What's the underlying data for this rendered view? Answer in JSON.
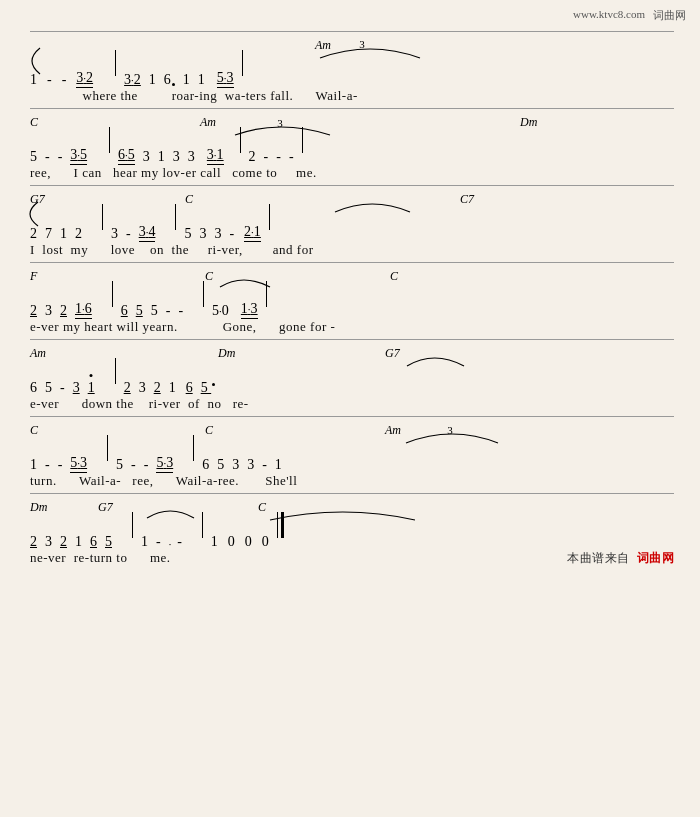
{
  "site": {
    "url": "www.ktvc8.com",
    "label": "词曲网"
  },
  "footer": {
    "source_text": "本曲谱来自",
    "site_label": "词曲网"
  },
  "rows": [
    {
      "id": "row1",
      "notation": "1   -   -   3·2 | 3·2  1  6  1  1   5·3 |",
      "chord_left": "",
      "chord_mid": "Am",
      "lyric": "where the         roar-ing  wa-ters  fall.       Wail-a-"
    },
    {
      "id": "row2",
      "notation": "5  -  -  3·5 | 6·5  3  1  3  3  3·1 | 2  -  -  -",
      "chord_left": "C",
      "chord_mid": "Am",
      "chord_right": "Dm",
      "lyric": "ree,      I can   hear my  lov-er call  come to    me."
    },
    {
      "id": "row3",
      "notation": "2  7  1  2 | 3  -  3·4 | 5  3  3  -  2·1 |",
      "chord_left": "G7",
      "chord_mid": "C",
      "chord_right": "C7",
      "lyric": "I  lost  my      love   on  the    ri-ver,      and for"
    },
    {
      "id": "row4",
      "notation": "2  3  2  1·6 | 6  5  5  -  - | 5·0  1·3 |",
      "chord_left": "F",
      "chord_mid": "C",
      "chord_right": "C",
      "lyric": "e-ver my heart will yearn.         Gone,    gone for -"
    },
    {
      "id": "row5",
      "notation": "6  5  -  3  1 | 2  3  2  1  6  5",
      "chord_left": "Am",
      "chord_mid": "Dm",
      "chord_right": "G7",
      "lyric": "e-ver     down the   ri-ver  of  no  re-"
    },
    {
      "id": "row6",
      "notation": "1  -  -  5·3 | 5  -  -  5·3 | 6  5  3  3  -  1",
      "chord_left": "C",
      "chord_mid": "C",
      "chord_right": "Am",
      "lyric": "turn.     Wail-a-   ree,      Wail-a-ree.       She'll"
    },
    {
      "id": "row7",
      "notation": "2  3  2  1  6  5 | 1  -  ·  -  |  1  0  0  0",
      "chord_left": "Dm",
      "chord_left2": "G7",
      "chord_mid": "C",
      "lyric": "ne-ver  re-turn to    me."
    }
  ]
}
